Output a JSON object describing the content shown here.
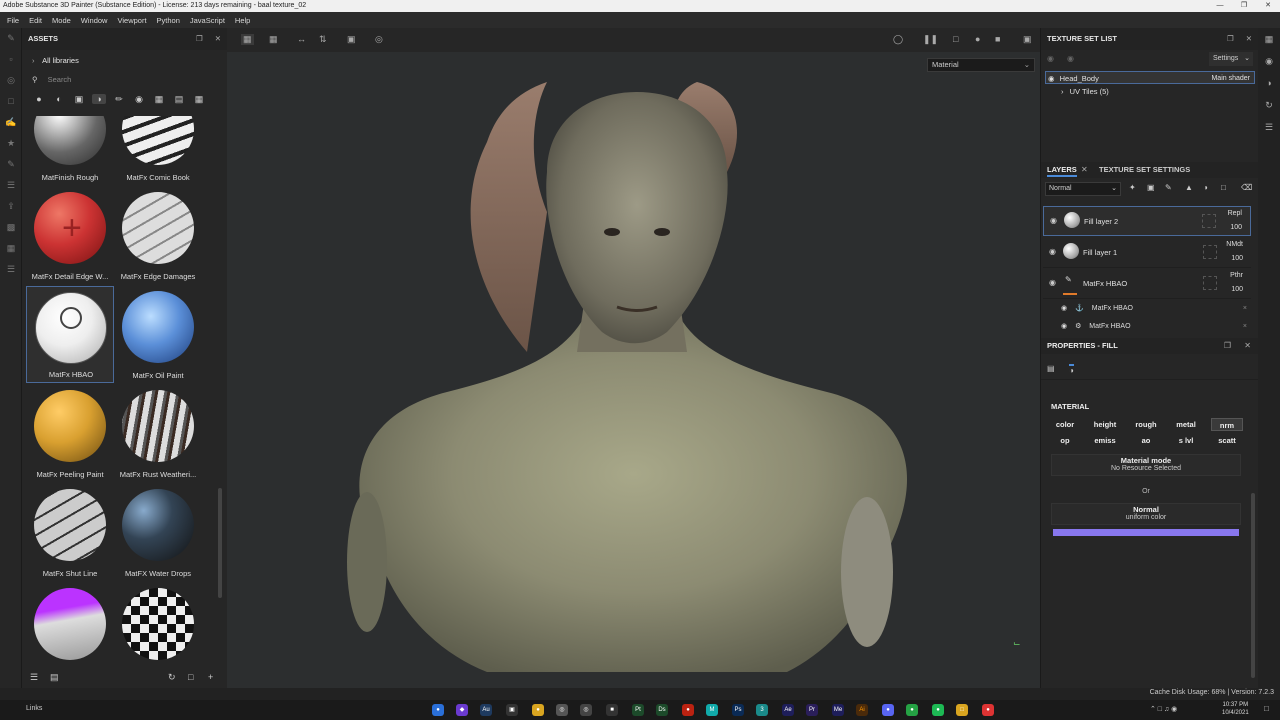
{
  "titlebar": {
    "title": "Adobe Substance 3D Painter (Substance Edition) - License: 213 days remaining - baal texture_02"
  },
  "menu": [
    "File",
    "Edit",
    "Mode",
    "Window",
    "Viewport",
    "Python",
    "JavaScript",
    "Help"
  ],
  "assets": {
    "title": "ASSETS",
    "library": "All libraries",
    "search_placeholder": "Search",
    "items": [
      {
        "label": "MatFinish Rough"
      },
      {
        "label": "MatFx Comic Book"
      },
      {
        "label": "MatFx Detail Edge W..."
      },
      {
        "label": "MatFx Edge Damages"
      },
      {
        "label": "MatFx HBAO"
      },
      {
        "label": "MatFx Oil Paint"
      },
      {
        "label": "MatFx Peeling Paint"
      },
      {
        "label": "MatFx Rust Weatheri..."
      },
      {
        "label": "MatFx Shut Line"
      },
      {
        "label": "MatFX Water Drops"
      }
    ]
  },
  "viewport": {
    "mode": "Material"
  },
  "texture_set_list": {
    "title": "TEXTURE SET LIST",
    "settings": "Settings",
    "set_name": "Head_Body",
    "shader": "Main shader",
    "uv_tiles": "UV Tiles (5)"
  },
  "layers": {
    "tab_layers": "LAYERS",
    "tab_tss": "TEXTURE SET SETTINGS",
    "blend_mode": "Normal",
    "items": [
      {
        "name": "Fill layer 2",
        "blend": "Repl",
        "opacity": "100"
      },
      {
        "name": "Fill layer 1",
        "blend": "NMdt",
        "opacity": "100"
      },
      {
        "name": "MatFx HBAO",
        "blend": "Pthr",
        "opacity": "100"
      }
    ],
    "subitems": [
      {
        "name": "MatFx HBAO"
      },
      {
        "name": "MatFx HBAO"
      }
    ]
  },
  "properties": {
    "title": "PROPERTIES - FILL",
    "section": "MATERIAL",
    "channels_row1": [
      "color",
      "height",
      "rough",
      "metal",
      "nrm"
    ],
    "channels_row2": [
      "op",
      "emiss",
      "ao",
      "s lvl",
      "scatt"
    ],
    "material_mode_label": "Material mode",
    "material_mode_value": "No Resource Selected",
    "or_label": "Or",
    "normal_label": "Normal",
    "normal_sub": "uniform color",
    "normal_color": "#8877ee"
  },
  "status": {
    "text": "Cache Disk Usage: 68% | Version: 7.2.3"
  },
  "taskbar": {
    "links": "Links",
    "time": "10:37 PM",
    "date": "10/4/2021"
  }
}
